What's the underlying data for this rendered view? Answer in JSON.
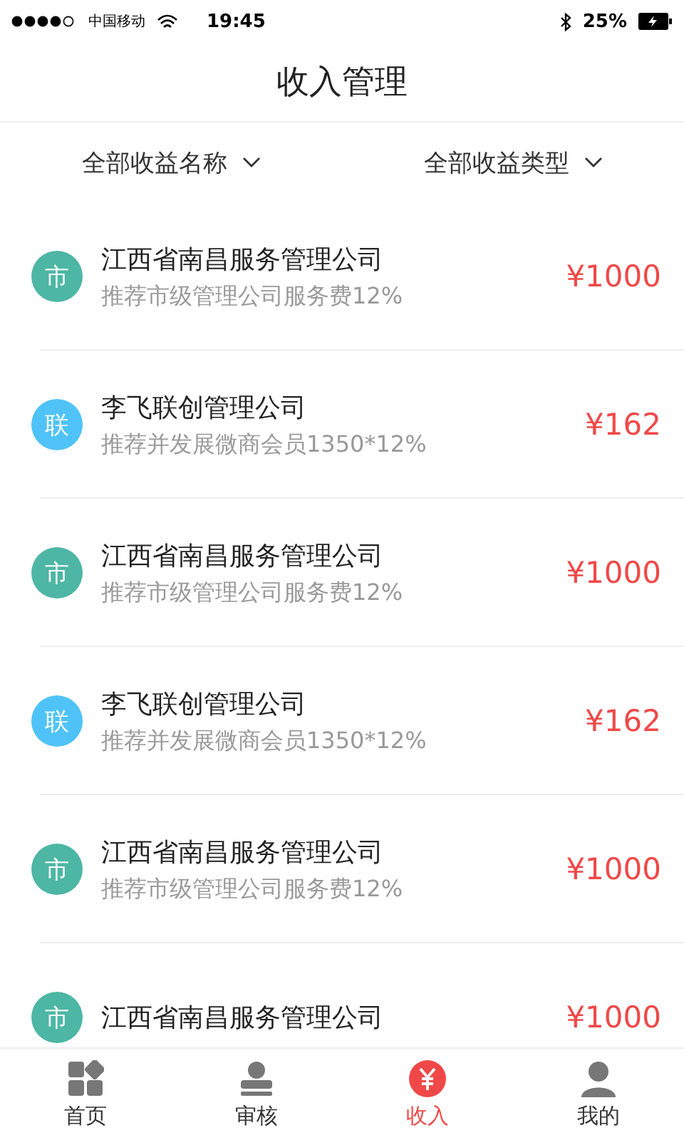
{
  "status_bar": {
    "carrier": "中国移动",
    "time": "19:45",
    "battery": "25%"
  },
  "header": {
    "title": "收入管理"
  },
  "filters": [
    {
      "label": "全部收益名称"
    },
    {
      "label": "全部收益类型"
    }
  ],
  "rows": [
    {
      "badge": "市",
      "color": "#4db6a4",
      "title": "江西省南昌服务管理公司",
      "subtitle": "推荐市级管理公司服务费12%",
      "amount": "¥1000"
    },
    {
      "badge": "联",
      "color": "#4fc3f7",
      "title": "李飞联创管理公司",
      "subtitle": "推荐并发展微商会员1350*12%",
      "amount": "¥162"
    },
    {
      "badge": "市",
      "color": "#4db6a4",
      "title": "江西省南昌服务管理公司",
      "subtitle": "推荐市级管理公司服务费12%",
      "amount": "¥1000"
    },
    {
      "badge": "联",
      "color": "#4fc3f7",
      "title": "李飞联创管理公司",
      "subtitle": "推荐并发展微商会员1350*12%",
      "amount": "¥162"
    },
    {
      "badge": "市",
      "color": "#4db6a4",
      "title": "江西省南昌服务管理公司",
      "subtitle": "推荐市级管理公司服务费12%",
      "amount": "¥1000"
    },
    {
      "badge": "市",
      "color": "#4db6a4",
      "title": "江西省南昌服务管理公司",
      "amount": "¥1000"
    }
  ],
  "tab_bar": [
    {
      "kind": "grid",
      "label": "首页",
      "selected": false
    },
    {
      "kind": "stamp",
      "label": "审核",
      "selected": false
    },
    {
      "kind": "yen",
      "label": "收入",
      "selected": true
    },
    {
      "kind": "person",
      "label": "我的",
      "selected": false
    }
  ]
}
